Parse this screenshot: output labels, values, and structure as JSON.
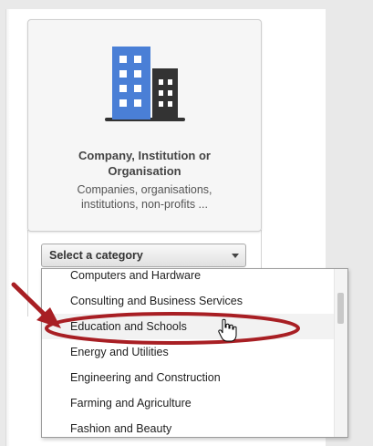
{
  "category_card": {
    "icon": "building-icon",
    "title_line1": "Company, Institution or",
    "title_line2": "Organisation",
    "desc_line1": "Companies, organisations,",
    "desc_line2": "institutions, non-profits ..."
  },
  "category_select": {
    "value": "Select a category",
    "caret_icon": "chevron-down-icon"
  },
  "dropdown": {
    "items": [
      {
        "label": "Computers and Hardware"
      },
      {
        "label": "Consulting and Business Services"
      },
      {
        "label": "Education and Schools"
      },
      {
        "label": "Energy and Utilities"
      },
      {
        "label": "Engineering and Construction"
      },
      {
        "label": "Farming and Agriculture"
      },
      {
        "label": "Fashion and Beauty"
      }
    ],
    "hovered_index": 2
  },
  "annotation": {
    "arrow_icon": "red-arrow-icon",
    "ellipse_icon": "red-ellipse-highlight-icon",
    "cursor_icon": "hand-pointer-cursor-icon",
    "color": "#a81f24"
  },
  "colors": {
    "building_blue": "#4a7fd6",
    "building_dark": "#333333"
  }
}
